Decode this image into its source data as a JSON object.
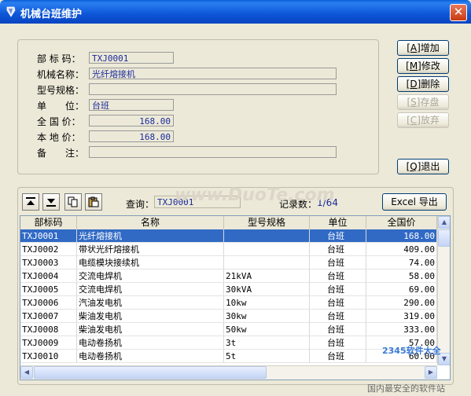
{
  "window": {
    "title": "机械台班维护",
    "close_glyph": "✕"
  },
  "form": {
    "fields": [
      {
        "label": "部 标 码：",
        "value": "TXJ0001"
      },
      {
        "label": "机械名称：",
        "value": "光纤熔接机"
      },
      {
        "label": "型号规格：",
        "value": ""
      },
      {
        "label": "单　　位：",
        "value": "台班"
      },
      {
        "label": "全 国 价：",
        "value": "168.00"
      },
      {
        "label": "本 地 价：",
        "value": "168.00"
      },
      {
        "label": "备　　注：",
        "value": ""
      }
    ]
  },
  "actions": {
    "add_key": "A",
    "add": "增加",
    "edit_key": "M",
    "edit": "修改",
    "delete_key": "D",
    "delete": "删除",
    "save_key": "S",
    "save": "存盘",
    "discard_key": "C",
    "discard": "放弃",
    "exit_key": "Q",
    "exit": "退出"
  },
  "toolbar": {
    "query_label": "查询：",
    "query_value": "TXJ0001",
    "count_label": "记录数：",
    "count_value": "1/64",
    "excel_label": "Excel 导出",
    "icons": [
      "move-up-icon",
      "move-down-icon",
      "copy-icon",
      "paste-icon"
    ]
  },
  "table": {
    "columns": [
      "部标码",
      "名称",
      "型号规格",
      "单位",
      "全国价"
    ],
    "rows": [
      [
        "TXJ0001",
        "光纤熔接机",
        "",
        "台班",
        "168.00"
      ],
      [
        "TXJ0002",
        "带状光纤熔接机",
        "",
        "台班",
        "409.00"
      ],
      [
        "TXJ0003",
        "电缆模块接续机",
        "",
        "台班",
        "74.00"
      ],
      [
        "TXJ0004",
        "交流电焊机",
        "21kVA",
        "台班",
        "58.00"
      ],
      [
        "TXJ0005",
        "交流电焊机",
        "30kVA",
        "台班",
        "69.00"
      ],
      [
        "TXJ0006",
        "汽油发电机",
        "10kw",
        "台班",
        "290.00"
      ],
      [
        "TXJ0007",
        "柴油发电机",
        "30kw",
        "台班",
        "319.00"
      ],
      [
        "TXJ0008",
        "柴油发电机",
        "50kw",
        "台班",
        "333.00"
      ],
      [
        "TXJ0009",
        "电动卷扬机",
        "3t",
        "台班",
        "57.00"
      ],
      [
        "TXJ0010",
        "电动卷扬机",
        "5t",
        "台班",
        "60.00"
      ]
    ],
    "selected_row": 0
  },
  "watermarks": {
    "site": "www.DuoTe.com",
    "brand": "2345软件大全",
    "slogan": "国内最安全的软件站"
  },
  "colors": {
    "selection": "#316ac5",
    "field_text": "#1a2a9a",
    "titlebar": "#0d56d8"
  }
}
